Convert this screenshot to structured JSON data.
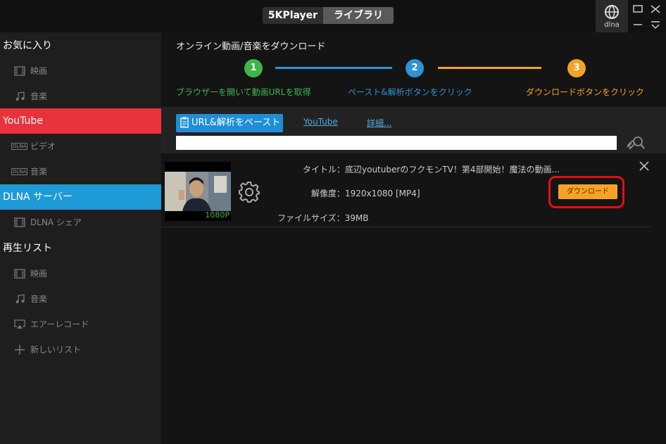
{
  "app": {
    "tabs": [
      "5KPlayer",
      "ライブラリ"
    ],
    "dlna_label": "dlna"
  },
  "sidebar": {
    "favorites": {
      "title": "お気に入り",
      "items": [
        {
          "label": "映画",
          "icon": "film-icon"
        },
        {
          "label": "音楽",
          "icon": "music-note-icon"
        }
      ]
    },
    "youtube": {
      "title": "YouTube",
      "items": [
        {
          "label": "ビデオ",
          "icon": "dlna-badge-icon",
          "badge": "DLNA"
        },
        {
          "label": "音楽",
          "icon": "dlna-badge-icon",
          "badge": "DLNA"
        }
      ]
    },
    "dlna_server": {
      "title": "DLNA サーバー",
      "items": [
        {
          "label": "DLNA シェア",
          "icon": "film-icon"
        }
      ]
    },
    "playlist": {
      "title": "再生リスト",
      "items": [
        {
          "label": "映画",
          "icon": "film-icon"
        },
        {
          "label": "音楽",
          "icon": "music-note-icon"
        },
        {
          "label": "エアーレコード",
          "icon": "airplay-icon"
        },
        {
          "label": "新しいリスト",
          "icon": "plus-icon"
        }
      ]
    }
  },
  "main": {
    "heading": "オンライン動画/音楽をダウンロード",
    "steps": [
      {
        "number": "1",
        "label": "ブラウザーを開いて動画URLを取得",
        "color": "#3db54a"
      },
      {
        "number": "2",
        "label": "ペースト&解析ボタンをクリック",
        "color": "#2e93d6"
      },
      {
        "number": "3",
        "label": "ダウンロードボタンをクリック",
        "color": "#f5a226"
      }
    ],
    "paste_button": "URL&解析をペースト",
    "links": {
      "youtube": "YouTube",
      "details": "詳細..."
    },
    "url_input": {
      "value": "",
      "placeholder": ""
    },
    "video": {
      "title": "タイトル：底辺youtuberのフクモンTV！第4部開始！魔法の動画...",
      "resolution": "解像度：1920x1080 [MP4]",
      "file_size": "ファイルサイズ：39MB",
      "thumb_badge": "1080P",
      "download_label": "ダウンロード"
    }
  }
}
